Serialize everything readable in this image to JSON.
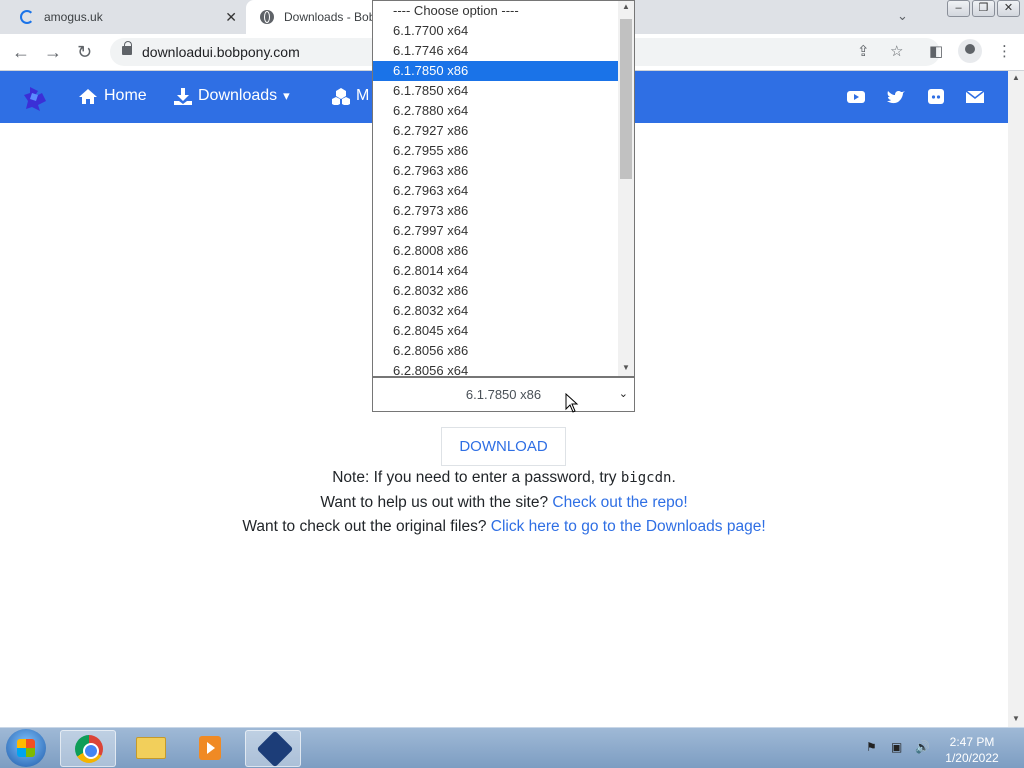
{
  "browser": {
    "tabs": [
      {
        "title": "amogus.uk",
        "state": "loading"
      },
      {
        "title": "Downloads - Bob",
        "state": "active"
      }
    ],
    "url": "downloadui.bobpony.com",
    "window_controls": [
      "minimize",
      "restore",
      "close"
    ]
  },
  "navbar": {
    "color": "#2f6fe4",
    "links": [
      {
        "label": "Home",
        "icon": "home-icon"
      },
      {
        "label": "Downloads",
        "icon": "download-icon",
        "dropdown": true
      },
      {
        "label": "M",
        "icon": "cubes-icon"
      }
    ],
    "social": [
      "youtube-icon",
      "twitter-icon",
      "discord-icon",
      "mail-icon"
    ]
  },
  "version_select": {
    "selected": "6.1.7850 x86",
    "options": [
      "---- Choose option ----",
      "6.1.7700 x64",
      "6.1.7746 x64",
      "6.1.7850 x86",
      "6.1.7850 x64",
      "6.2.7880 x64",
      "6.2.7927 x86",
      "6.2.7955 x86",
      "6.2.7963 x86",
      "6.2.7963 x64",
      "6.2.7973 x86",
      "6.2.7997 x64",
      "6.2.8008 x86",
      "6.2.8014 x64",
      "6.2.8032 x86",
      "6.2.8032 x64",
      "6.2.8045 x64",
      "6.2.8056 x86",
      "6.2.8056 x64"
    ],
    "highlighted_index": 3
  },
  "download_button": "DOWNLOAD",
  "notes": {
    "password_prefix": "Note: If you need to enter a password, try ",
    "password_code": "bigcdn",
    "password_suffix": ".",
    "repo_prefix": "Want to help us out with the site? ",
    "repo_link": "Check out the repo!",
    "files_prefix": "Want to check out the original files? ",
    "files_link": "Click here to go to the Downloads page!"
  },
  "taskbar": {
    "apps": [
      "chrome-icon",
      "explorer-icon",
      "media-player-icon",
      "virtualbox-icon"
    ],
    "clock_time": "2:47 PM",
    "clock_date": "1/20/2022"
  }
}
